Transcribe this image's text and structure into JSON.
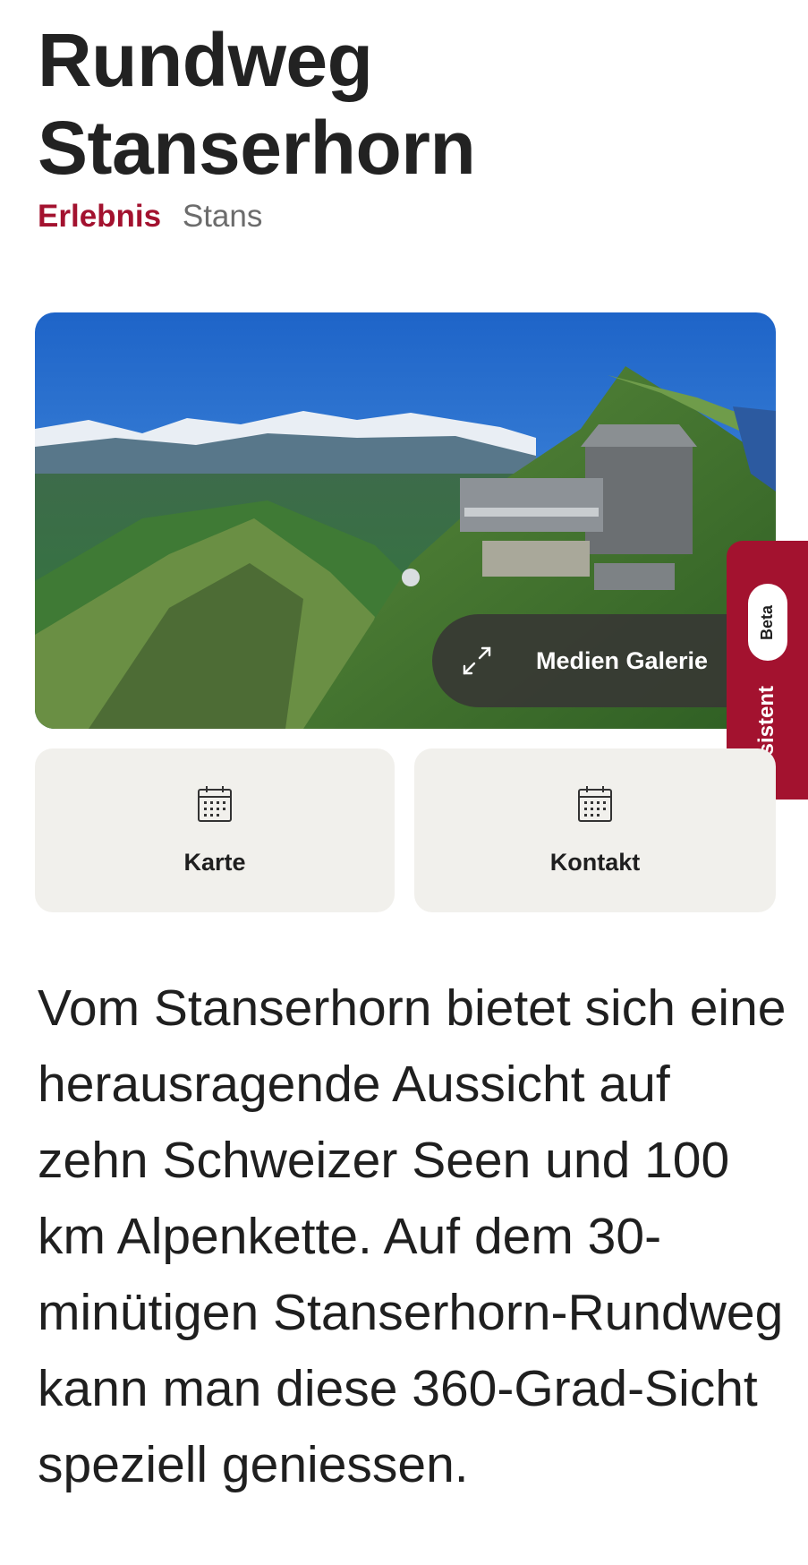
{
  "page": {
    "title_line1": "Rundweg",
    "title_line2": "Stanserhorn",
    "category": "Erlebnis",
    "location": "Stans"
  },
  "hero": {
    "gallery_label": "Medien Galerie",
    "gallery_icon": "expand-icon"
  },
  "assistant": {
    "label": "Assistent",
    "badge": "Beta"
  },
  "actions": [
    {
      "label": "Karte",
      "icon": "calendar-icon"
    },
    {
      "label": "Kontakt",
      "icon": "calendar-icon"
    }
  ],
  "description": "Vom Stanserhorn bietet sich eine herausragende Aussicht auf zehn Schweizer Seen und 100 km Alpenkette. Auf dem 30-minütigen Stanserhorn-Rundweg kann man diese 360-Grad-Sicht speziell geniessen.",
  "colors": {
    "accent": "#a3122f",
    "tile_bg": "#f1f0ec",
    "text": "#1f1f1f",
    "muted": "#6c6c6c"
  }
}
